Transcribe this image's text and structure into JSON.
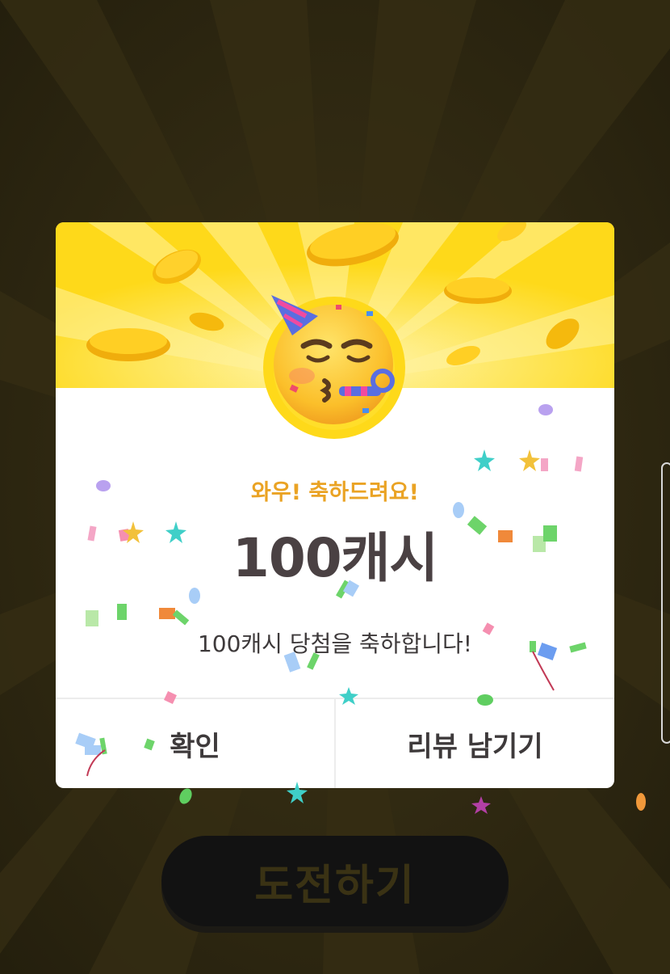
{
  "dialog": {
    "subtitle": "와우! 축하드려요!",
    "amount": "100캐시",
    "message": "100캐시 당첨을 축하합니다!",
    "confirm_label": "확인",
    "review_label": "리뷰 남기기",
    "emoji_icon": "partying-face-icon"
  },
  "background": {
    "challenge_label": "도전하기"
  },
  "colors": {
    "header_yellow": "#fed91a",
    "subtitle_orange": "#eaa324",
    "amount_text": "#4a4143",
    "backdrop": "#2b2511"
  }
}
